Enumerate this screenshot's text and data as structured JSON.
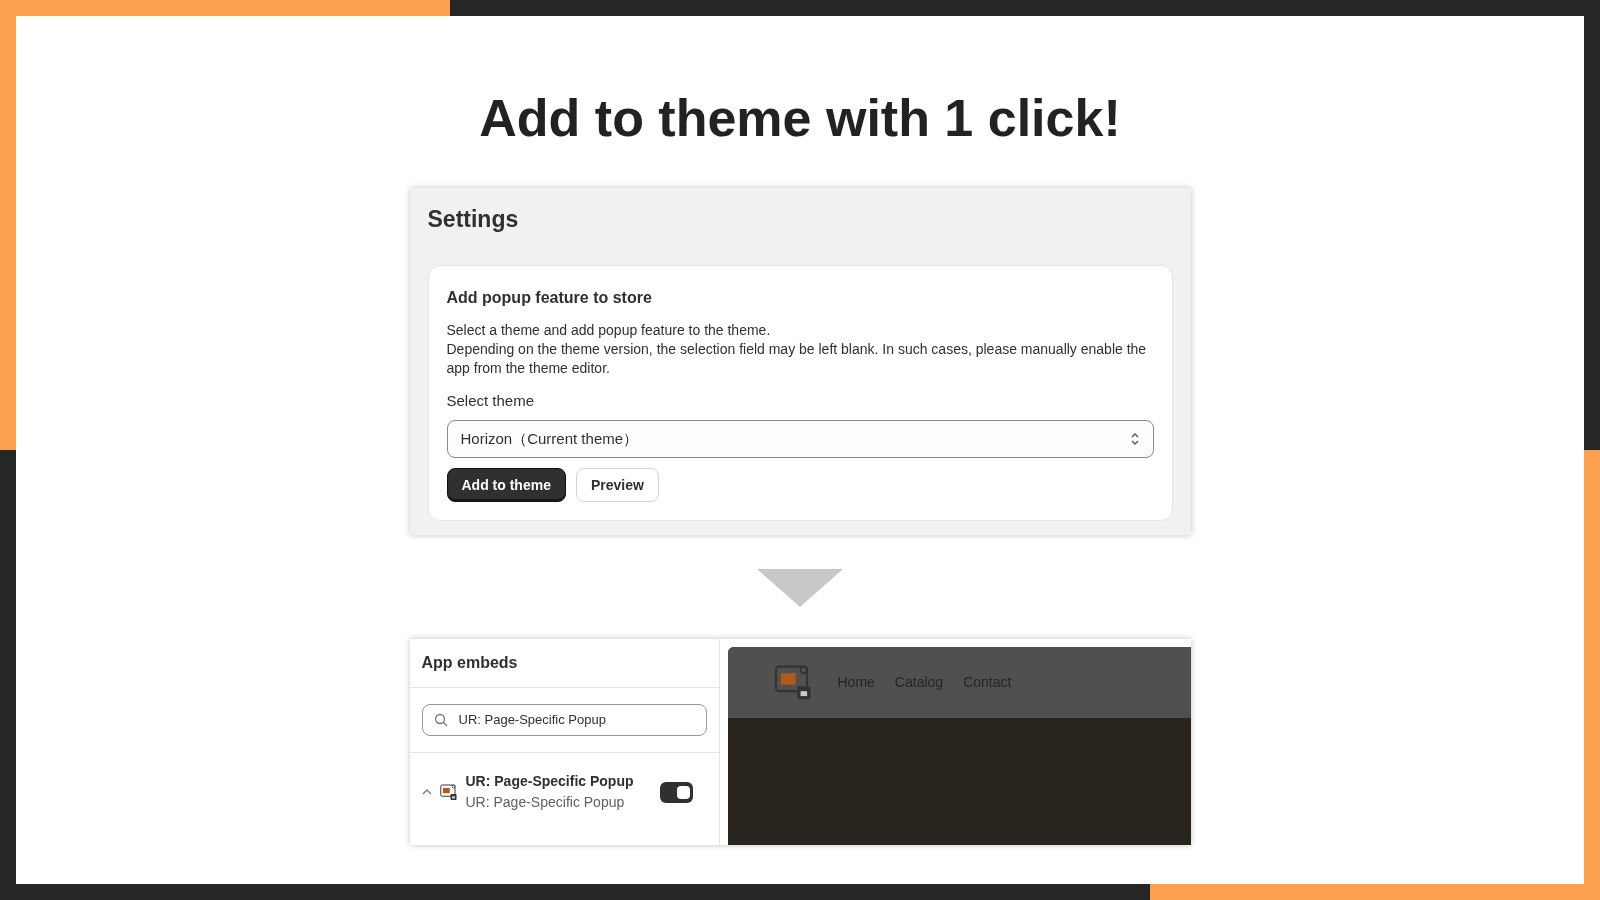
{
  "headline": "Add to theme with 1 click!",
  "settings": {
    "title": "Settings",
    "card": {
      "heading": "Add popup feature to store",
      "lines": [
        "Select a theme and add popup feature to the theme.",
        "Depending on the theme version, the selection field may be left blank. In such cases, please manually enable the app from the theme editor."
      ],
      "select_label": "Select theme",
      "select_value": "Horizon（Current theme）",
      "buttons": [
        {
          "label": "Add to theme",
          "kind": "primary"
        },
        {
          "label": "Preview",
          "kind": "secondary"
        }
      ]
    }
  },
  "app_embeds": {
    "title": "App embeds",
    "search_value": "UR: Page-Specific Popup",
    "items": [
      {
        "title": "UR: Page-Specific Popup",
        "subtitle": "UR: Page-Specific Popup",
        "expanded": true,
        "on": true
      }
    ]
  },
  "preview": {
    "nav": [
      "Home",
      "Catalog",
      "Contact"
    ]
  }
}
